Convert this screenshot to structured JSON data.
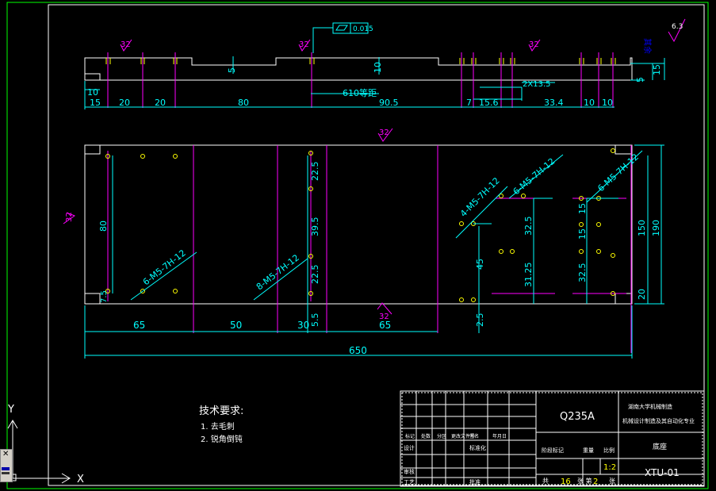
{
  "colors": {
    "background": "#000000",
    "outline": "#ffffff",
    "dimension": "#00ffff",
    "accent": "#ff00ff",
    "holes": "#ffff00",
    "border": "#00ff00",
    "leader": "#0000ff"
  },
  "top_view": {
    "roughness": [
      "32",
      "32",
      "32"
    ],
    "tolerance_value": "0.015",
    "overall_label": "610等距",
    "slot_label": "2X13.5",
    "depth_labels": [
      "5",
      "10"
    ],
    "right_dims": [
      "5",
      "15"
    ],
    "bottom_dims": [
      "10",
      "15",
      "20",
      "20",
      "80",
      "90.5",
      "7",
      "15.6",
      "33.4",
      "10",
      "10"
    ]
  },
  "front_view": {
    "top_roughness": "32",
    "left_roughness": "32",
    "bottom_roughness": "32",
    "height_dim": "80",
    "edge_dim": "7.5",
    "thread_labels": [
      "6-M5-7H-12",
      "8-M5-7H-12",
      "4-M5-7H-12",
      "6-M5-7H-12",
      "6-M5-7H-12"
    ],
    "mid_dims": [
      "22.5",
      "39.5",
      "22.5",
      "5.5"
    ],
    "lower_dims": [
      "45",
      "2.5",
      "32.5",
      "31.25",
      "15",
      "15",
      "32.5"
    ],
    "right_dims": [
      "150",
      "190",
      "20"
    ],
    "bottom_dims": [
      "65",
      "50",
      "30",
      "65"
    ],
    "total_width": "650"
  },
  "surface_finish": {
    "label": "其余",
    "value": "6.3"
  },
  "notes": {
    "title": "技术要求:",
    "items": [
      "1. 去毛刺",
      "2. 锐角倒钝"
    ]
  },
  "title_block": {
    "material": "Q235A",
    "school": "湖南大学机械制造",
    "project": "机械设计制造及其自动化专业",
    "part_name": "底座",
    "drawing_number": "XTU-01",
    "scale_value": "1:2",
    "sheets": "16",
    "sheet_no": "2",
    "total_label": "共",
    "sheet_label": "张 第",
    "sheet_end": "张",
    "header_cells": [
      "标记",
      "处数",
      "分区",
      "更改文件号",
      "签名",
      "年月日"
    ],
    "row_labels": [
      "设计",
      "审核",
      "工艺"
    ],
    "row_cells": [
      "标准化",
      "批准"
    ],
    "stage_labels": [
      "阶段标记",
      "重量",
      "比例"
    ]
  },
  "ucs": {
    "x_label": "X",
    "y_label": "Y"
  }
}
